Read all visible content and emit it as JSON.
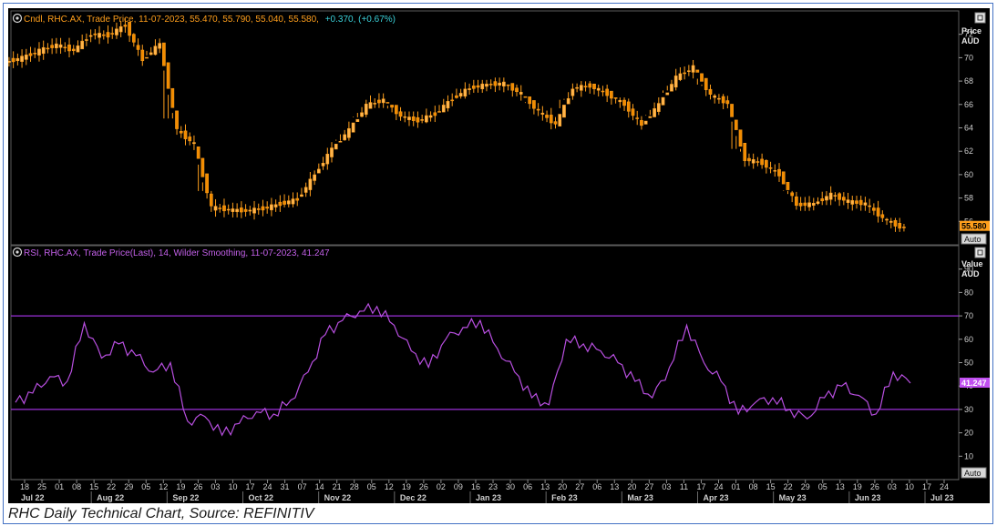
{
  "colors": {
    "background": "#000000",
    "price": "#ff9f1c",
    "rsi": "#b84fe0",
    "rsi_levels": "#9b30d9",
    "axis_text": "#cfcfcf",
    "header_teal": "#3ad0d8"
  },
  "icons": {
    "panel_toggle": "circle-info-icon",
    "window_restore": "window-restore-icon"
  },
  "price_panel": {
    "legend_prefix": "Cndl, RHC.AX, Trade Price, 11-07-2023, 55.470, 55.790, 55.040, 55.580,",
    "legend_change": "+0.370, (+0.67%)",
    "axis_title_1": "Price",
    "axis_title_2": "AUD",
    "last_value_label": "55.580",
    "auto_label": "Auto"
  },
  "rsi_panel": {
    "legend": "RSI, RHC.AX, Trade Price(Last), 14, Wilder Smoothing, 11-07-2023, 41.247",
    "axis_title_1": "Value",
    "axis_title_2": "AUD",
    "last_value_label": "41.247",
    "auto_label": "Auto"
  },
  "caption": "RHC Daily Technical Chart, Source: REFINITIV",
  "chart_data": [
    {
      "type": "line",
      "title": "Cndl, RHC.AX, Trade Price",
      "ylabel": "Price AUD",
      "ylim": [
        54,
        74
      ],
      "y_ticks": [
        56,
        58,
        60,
        62,
        64,
        66,
        68,
        70,
        72
      ],
      "x": [
        "2022-07-11",
        "2022-07-18",
        "2022-07-25",
        "2022-08-01",
        "2022-08-08",
        "2022-08-15",
        "2022-08-22",
        "2022-08-29",
        "2022-09-05",
        "2022-09-12",
        "2022-09-19",
        "2022-09-26",
        "2022-10-03",
        "2022-10-10",
        "2022-10-17",
        "2022-10-24",
        "2022-10-31",
        "2022-11-07",
        "2022-11-14",
        "2022-11-21",
        "2022-11-28",
        "2022-12-05",
        "2022-12-12",
        "2022-12-19",
        "2022-12-26",
        "2023-01-02",
        "2023-01-09",
        "2023-01-16",
        "2023-01-23",
        "2023-01-30",
        "2023-02-06",
        "2023-02-13",
        "2023-02-20",
        "2023-02-27",
        "2023-03-06",
        "2023-03-13",
        "2023-03-20",
        "2023-03-27",
        "2023-04-03",
        "2023-04-10",
        "2023-04-17",
        "2023-04-24",
        "2023-05-01",
        "2023-05-08",
        "2023-05-15",
        "2023-05-22",
        "2023-05-29",
        "2023-06-05",
        "2023-06-12",
        "2023-06-19",
        "2023-06-26",
        "2023-07-03",
        "2023-07-10"
      ],
      "close": [
        70.0,
        70.6,
        71.1,
        70.6,
        72.0,
        71.9,
        72.8,
        69.8,
        71.2,
        63.8,
        62.6,
        57.2,
        57.0,
        56.9,
        57.1,
        57.5,
        57.9,
        60.0,
        62.2,
        63.8,
        65.9,
        66.4,
        65.0,
        64.6,
        65.2,
        66.5,
        67.4,
        67.7,
        67.8,
        66.9,
        65.4,
        64.3,
        67.4,
        67.6,
        66.9,
        66.0,
        64.2,
        66.0,
        68.3,
        69.2,
        66.8,
        66.1,
        61.3,
        61.0,
        60.0,
        57.4,
        57.5,
        58.3,
        57.7,
        57.5,
        56.3,
        55.5,
        55.58
      ],
      "high": [
        71.8,
        71.6,
        72.1,
        72.9,
        73.1,
        73.0,
        73.6,
        72.1,
        72.8,
        64.8,
        64.3,
        58.6,
        58.3,
        58.0,
        58.1,
        58.6,
        59.0,
        61.4,
        63.0,
        64.8,
        66.4,
        67.1,
        65.9,
        65.4,
        66.0,
        67.2,
        67.9,
        68.1,
        68.3,
        67.7,
        66.2,
        66.8,
        68.2,
        68.0,
        67.7,
        66.6,
        66.5,
        67.2,
        69.3,
        69.8,
        67.7,
        66.9,
        62.2,
        61.8,
        61.3,
        58.6,
        58.4,
        59.1,
        58.5,
        58.2,
        58.9,
        56.3,
        55.79
      ],
      "low": [
        69.0,
        69.1,
        69.8,
        69.5,
        70.9,
        70.7,
        71.6,
        67.6,
        70.2,
        60.1,
        59.8,
        56.3,
        56.2,
        56.1,
        56.0,
        56.4,
        57.2,
        58.1,
        60.4,
        62.9,
        64.9,
        65.7,
        63.9,
        63.8,
        64.4,
        65.4,
        66.5,
        67.0,
        66.9,
        66.2,
        64.6,
        63.3,
        66.4,
        66.6,
        66.1,
        64.9,
        63.0,
        65.1,
        67.2,
        68.0,
        65.9,
        63.8,
        60.3,
        60.5,
        59.1,
        57.0,
        56.9,
        57.4,
        57.0,
        56.6,
        54.6,
        55.1,
        55.04
      ]
    },
    {
      "type": "line",
      "title": "RSI, RHC.AX, Trade Price(Last), 14, Wilder Smoothing",
      "ylabel": "Value AUD",
      "ylim": [
        0,
        100
      ],
      "y_ticks": [
        10,
        20,
        30,
        40,
        50,
        60,
        70,
        80,
        90
      ],
      "levels": [
        30,
        70
      ],
      "x": [
        "2022-07-11",
        "2022-07-18",
        "2022-07-25",
        "2022-08-01",
        "2022-08-08",
        "2022-08-15",
        "2022-08-22",
        "2022-08-29",
        "2022-09-05",
        "2022-09-12",
        "2022-09-19",
        "2022-09-26",
        "2022-10-03",
        "2022-10-10",
        "2022-10-17",
        "2022-10-24",
        "2022-10-31",
        "2022-11-07",
        "2022-11-14",
        "2022-11-21",
        "2022-11-28",
        "2022-12-05",
        "2022-12-12",
        "2022-12-19",
        "2022-12-26",
        "2023-01-02",
        "2023-01-09",
        "2023-01-16",
        "2023-01-23",
        "2023-01-30",
        "2023-02-06",
        "2023-02-13",
        "2023-02-20",
        "2023-02-27",
        "2023-03-06",
        "2023-03-13",
        "2023-03-20",
        "2023-03-27",
        "2023-04-03",
        "2023-04-10",
        "2023-04-17",
        "2023-04-24",
        "2023-05-01",
        "2023-05-08",
        "2023-05-15",
        "2023-05-22",
        "2023-05-29",
        "2023-06-05",
        "2023-06-12",
        "2023-06-19",
        "2023-06-26",
        "2023-07-03",
        "2023-07-10"
      ],
      "values": [
        33,
        37,
        44,
        42,
        67,
        52,
        58,
        53,
        46,
        50,
        25,
        27,
        19,
        24,
        29,
        28,
        34,
        46,
        62,
        68,
        72,
        74,
        66,
        55,
        48,
        60,
        65,
        68,
        56,
        46,
        35,
        32,
        60,
        58,
        55,
        50,
        42,
        35,
        48,
        66,
        50,
        42,
        28,
        33,
        35,
        30,
        26,
        35,
        40,
        36,
        28,
        46,
        41.247
      ]
    }
  ],
  "x_axis": {
    "day_ticks": [
      "18",
      "25",
      "01",
      "08",
      "15",
      "22",
      "29",
      "05",
      "12",
      "19",
      "26",
      "03",
      "10",
      "17",
      "24",
      "31",
      "07",
      "14",
      "21",
      "28",
      "05",
      "12",
      "19",
      "26",
      "02",
      "09",
      "16",
      "23",
      "30",
      "06",
      "13",
      "20",
      "27",
      "06",
      "13",
      "20",
      "27",
      "03",
      "11",
      "17",
      "24",
      "01",
      "08",
      "15",
      "22",
      "29",
      "05",
      "13",
      "19",
      "26",
      "03",
      "10",
      "17",
      "24"
    ],
    "months": [
      "Jul 22",
      "Aug 22",
      "Sep 22",
      "Oct 22",
      "Nov 22",
      "Dec 22",
      "Jan 23",
      "Feb 23",
      "Mar 23",
      "Apr 23",
      "May 23",
      "Jun 23",
      "Jul 23"
    ]
  }
}
